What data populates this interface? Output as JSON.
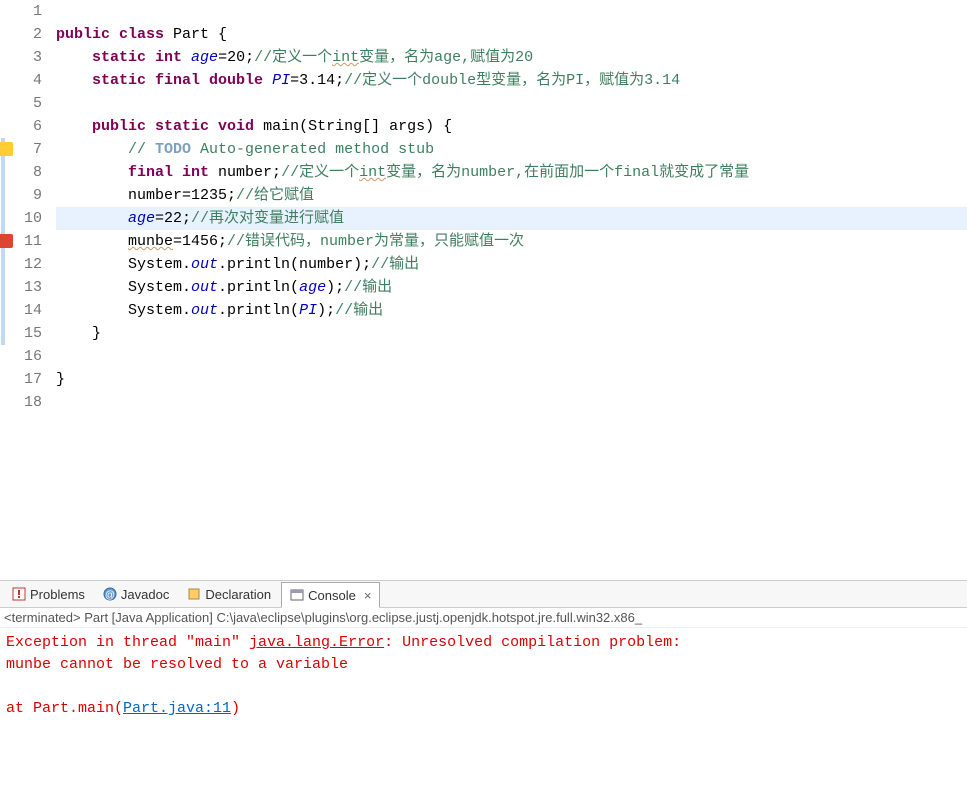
{
  "lines": [
    {
      "n": 1,
      "tokens": []
    },
    {
      "n": 2,
      "tokens": [
        {
          "t": "public ",
          "c": "kw"
        },
        {
          "t": "class ",
          "c": "kw"
        },
        {
          "t": "Part ",
          "c": "cls"
        },
        {
          "t": "{"
        }
      ]
    },
    {
      "n": 3,
      "tokens": [
        {
          "t": "    "
        },
        {
          "t": "static ",
          "c": "kw"
        },
        {
          "t": "int ",
          "c": "kw"
        },
        {
          "t": "age",
          "c": "fld"
        },
        {
          "t": "=20;"
        },
        {
          "t": "//定义一个",
          "c": "cmt"
        },
        {
          "t": "int",
          "c": "cmt spell"
        },
        {
          "t": "变量，名为age,赋值为20",
          "c": "cmt"
        }
      ]
    },
    {
      "n": 4,
      "tokens": [
        {
          "t": "    "
        },
        {
          "t": "static ",
          "c": "kw"
        },
        {
          "t": "final ",
          "c": "kw"
        },
        {
          "t": "double ",
          "c": "kw"
        },
        {
          "t": "PI",
          "c": "fld"
        },
        {
          "t": "=3.14;"
        },
        {
          "t": "//定义一个double型变量，名为PI，赋值为3.14",
          "c": "cmt"
        }
      ]
    },
    {
      "n": 5,
      "tokens": []
    },
    {
      "n": 6,
      "tokens": [
        {
          "t": "    "
        },
        {
          "t": "public ",
          "c": "kw"
        },
        {
          "t": "static ",
          "c": "kw"
        },
        {
          "t": "void ",
          "c": "kw"
        },
        {
          "t": "main(String[] args) {"
        }
      ],
      "marker": "run"
    },
    {
      "n": 7,
      "tokens": [
        {
          "t": "        "
        },
        {
          "t": "// ",
          "c": "cmt"
        },
        {
          "t": "TODO",
          "c": "task"
        },
        {
          "t": " Auto-generated method stub",
          "c": "cmt"
        }
      ],
      "marker": "warn",
      "change": true
    },
    {
      "n": 8,
      "tokens": [
        {
          "t": "        "
        },
        {
          "t": "final ",
          "c": "kw"
        },
        {
          "t": "int ",
          "c": "kw"
        },
        {
          "t": "number;"
        },
        {
          "t": "//定义一个",
          "c": "cmt"
        },
        {
          "t": "int",
          "c": "cmt spell"
        },
        {
          "t": "变量，名为number,在前面加一个final就变成了常量",
          "c": "cmt"
        }
      ],
      "change": true
    },
    {
      "n": 9,
      "tokens": [
        {
          "t": "        number=1235;"
        },
        {
          "t": "//给它赋值",
          "c": "cmt"
        }
      ],
      "change": true
    },
    {
      "n": 10,
      "tokens": [
        {
          "t": "        "
        },
        {
          "t": "age",
          "c": "fld"
        },
        {
          "t": "=22;"
        },
        {
          "t": "//再次对变量进行赋值",
          "c": "cmt"
        }
      ],
      "hl": true,
      "change": true
    },
    {
      "n": 11,
      "tokens": [
        {
          "t": "        "
        },
        {
          "t": "munbe",
          "c": "spell"
        },
        {
          "t": "=1456;"
        },
        {
          "t": "//错误代码，number为常量，只能赋值一次",
          "c": "cmt"
        }
      ],
      "marker": "err",
      "change": true
    },
    {
      "n": 12,
      "tokens": [
        {
          "t": "        System."
        },
        {
          "t": "out",
          "c": "fld"
        },
        {
          "t": ".println(number);"
        },
        {
          "t": "//输出",
          "c": "cmt"
        }
      ],
      "change": true
    },
    {
      "n": 13,
      "tokens": [
        {
          "t": "        System."
        },
        {
          "t": "out",
          "c": "fld"
        },
        {
          "t": ".println("
        },
        {
          "t": "age",
          "c": "fld"
        },
        {
          "t": ");"
        },
        {
          "t": "//输出",
          "c": "cmt"
        }
      ],
      "change": true
    },
    {
      "n": 14,
      "tokens": [
        {
          "t": "        System."
        },
        {
          "t": "out",
          "c": "fld"
        },
        {
          "t": ".println("
        },
        {
          "t": "PI",
          "c": "fld"
        },
        {
          "t": ");"
        },
        {
          "t": "//输出",
          "c": "cmt"
        }
      ],
      "change": true
    },
    {
      "n": 15,
      "tokens": [
        {
          "t": "    }"
        }
      ],
      "change": true
    },
    {
      "n": 16,
      "tokens": []
    },
    {
      "n": 17,
      "tokens": [
        {
          "t": "}"
        }
      ]
    },
    {
      "n": 18,
      "tokens": []
    }
  ],
  "tabs": {
    "problems": "Problems",
    "javadoc": "Javadoc",
    "declaration": "Declaration",
    "console": "Console"
  },
  "status": "<terminated> Part [Java Application] C:\\java\\eclipse\\plugins\\org.eclipse.justj.openjdk.hotspot.jre.full.win32.x86_",
  "console": {
    "l1a": "Exception in thread \"main\" ",
    "l1b": "java.lang.Error",
    "l1c": ": Unresolved compilation problem: ",
    "l2": "\tmunbe cannot be resolved to a variable",
    "l3": "",
    "l4a": "\tat Part.main(",
    "l4b": "Part.java:11",
    "l4c": ")"
  },
  "close_x": "×"
}
